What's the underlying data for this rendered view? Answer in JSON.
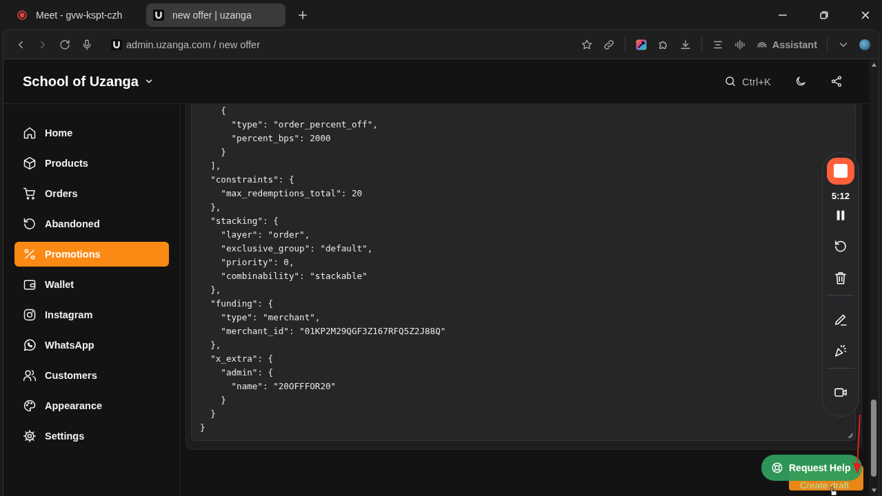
{
  "browser": {
    "tabs": [
      {
        "title": "Meet - gvw-kspt-czh",
        "selected": false
      },
      {
        "title": "new offer | uzanga",
        "selected": true
      }
    ],
    "address": "admin.uzanga.com / new offer",
    "assistant": "Assistant"
  },
  "header": {
    "store_name": "School of Uzanga",
    "search_shortcut": "Ctrl+K"
  },
  "sidebar": {
    "items": [
      {
        "label": "Home",
        "selected": false
      },
      {
        "label": "Products",
        "selected": false
      },
      {
        "label": "Orders",
        "selected": false
      },
      {
        "label": "Abandoned",
        "selected": false
      },
      {
        "label": "Promotions",
        "selected": true
      },
      {
        "label": "Wallet",
        "selected": false
      },
      {
        "label": "Instagram",
        "selected": false
      },
      {
        "label": "WhatsApp",
        "selected": false
      },
      {
        "label": "Customers",
        "selected": false
      },
      {
        "label": "Appearance",
        "selected": false
      },
      {
        "label": "Settings",
        "selected": false
      }
    ]
  },
  "editor": {
    "lines": [
      "    {",
      "      \"type\": \"order_percent_off\",",
      "      \"percent_bps\": 2000",
      "    }",
      "  ],",
      "  \"constraints\": {",
      "    \"max_redemptions_total\": 20",
      "  },",
      "  \"stacking\": {",
      "    \"layer\": \"order\",",
      "    \"exclusive_group\": \"default\",",
      "    \"priority\": 0,",
      "    \"combinability\": \"stackable\"",
      "  },",
      "  \"funding\": {",
      "    \"type\": \"merchant\",",
      "    \"merchant_id\": \"01KP2M29QGF3Z167RFQ5Z2J88Q\"",
      "  },",
      "  \"x_extra\": {",
      "    \"admin\": {",
      "      \"name\": \"20OFFFOR20\"",
      "    }",
      "  }",
      "}"
    ]
  },
  "recorder": {
    "timer": "5:12"
  },
  "buttons": {
    "request_help": "Request Help",
    "create_draft": "Create draft"
  }
}
